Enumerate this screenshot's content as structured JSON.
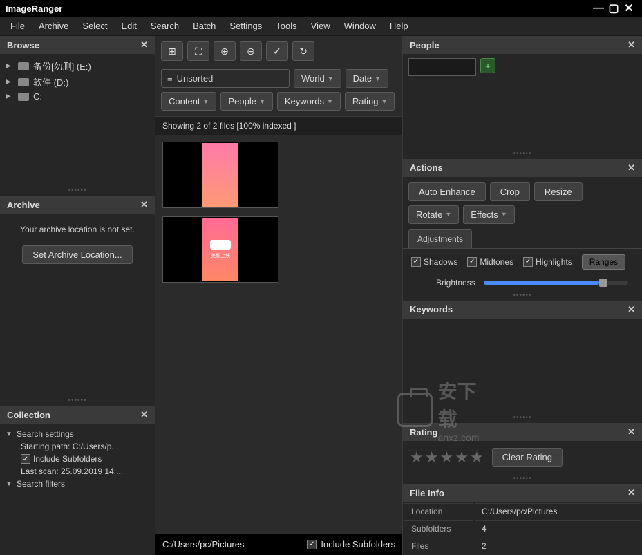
{
  "app": {
    "title": "ImageRanger"
  },
  "menu": [
    "File",
    "Archive",
    "Select",
    "Edit",
    "Search",
    "Batch",
    "Settings",
    "Tools",
    "View",
    "Window",
    "Help"
  ],
  "browse": {
    "title": "Browse",
    "drives": [
      {
        "label": "备份[勿删] (E:)"
      },
      {
        "label": "软件 (D:)"
      },
      {
        "label": "C:"
      }
    ]
  },
  "archive": {
    "title": "Archive",
    "message": "Your archive location is not set.",
    "button": "Set Archive Location..."
  },
  "collection": {
    "title": "Collection",
    "search_settings": "Search settings",
    "starting_path_label": "Starting path: C:/Users/p...",
    "include_subfolders": "Include Subfolders",
    "last_scan": "Last scan: 25.09.2019 14:...",
    "search_filters": "Search filters"
  },
  "toolbar": {
    "unsorted": "Unsorted",
    "world": "World",
    "date": "Date",
    "content": "Content",
    "people": "People",
    "keywords": "Keywords",
    "rating": "Rating"
  },
  "status": "Showing 2 of 2 files [100% indexed ]",
  "footer": {
    "path": "C:/Users/pc/Pictures",
    "include_subfolders": "Include Subfolders"
  },
  "people": {
    "title": "People"
  },
  "actions": {
    "title": "Actions",
    "auto_enhance": "Auto Enhance",
    "crop": "Crop",
    "resize": "Resize",
    "rotate": "Rotate",
    "effects": "Effects",
    "adjustments_tab": "Adjustments",
    "shadows": "Shadows",
    "midtones": "Midtones",
    "highlights": "Highlights",
    "ranges": "Ranges",
    "brightness": "Brightness"
  },
  "keywords": {
    "title": "Keywords"
  },
  "rating": {
    "title": "Rating",
    "clear": "Clear Rating"
  },
  "fileinfo": {
    "title": "File Info",
    "rows": {
      "location_label": "Location",
      "location_value": "C:/Users/pc/Pictures",
      "subfolders_label": "Subfolders",
      "subfolders_value": "4",
      "files_label": "Files",
      "files_value": "2"
    }
  },
  "watermark": {
    "main": "安下载",
    "sub": "anxz.com"
  }
}
